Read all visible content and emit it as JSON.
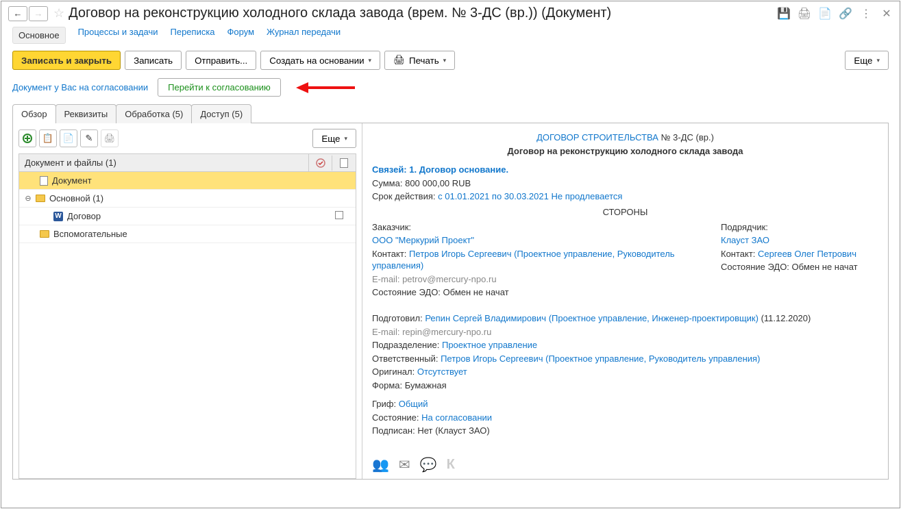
{
  "title": "Договор на реконструкцию холодного склада завода (врем. № 3-ДС (вр.)) (Документ)",
  "nav": {
    "main": "Основное",
    "processes": "Процессы и задачи",
    "correspondence": "Переписка",
    "forum": "Форум",
    "transferlog": "Журнал передачи"
  },
  "toolbar": {
    "save_close": "Записать и закрыть",
    "save": "Записать",
    "send": "Отправить...",
    "create_based": "Создать на основании",
    "print": "Печать",
    "more": "Еще"
  },
  "status": {
    "text": "Документ у Вас на согласовании",
    "action": "Перейти к согласованию"
  },
  "tabs": {
    "overview": "Обзор",
    "props": "Реквизиты",
    "processing": "Обработка (5)",
    "access": "Доступ (5)"
  },
  "tree": {
    "header": "Документ и файлы (1)",
    "r1": "Документ",
    "r2": "Основной (1)",
    "r3": "Договор",
    "r4": "Вспомогательные"
  },
  "more": "Еще",
  "doc": {
    "type": "ДОГОВОР СТРОИТЕЛЬСТВА",
    "num": "№ 3-ДС (вр.)",
    "name": "Договор на реконструкцию холодного склада завода",
    "links": "Связей: 1. Договор основание.",
    "sum_label": "Сумма:",
    "sum": "800 000,00 RUB",
    "period_label": "Срок действия:",
    "period": "с 01.01.2021 по 30.03.2021 Не продлевается",
    "sides": "СТОРОНЫ",
    "customer_label": "Заказчик:",
    "customer": "ООО \"Меркурий Проект\"",
    "contact_label": "Контакт:",
    "customer_contact": "Петров Игорь Сергеевич (Проектное управление, Руководитель управления)",
    "email_label": "E-mail:",
    "customer_email": "petrov@mercury-npo.ru",
    "edo_label": "Состояние ЭДО:",
    "edo_val": "Обмен не начат",
    "contractor_label": "Подрядчик:",
    "contractor": "Клауст ЗАО",
    "contractor_contact": "Сергеев Олег Петрович",
    "prepared_label": "Подготовил:",
    "prepared": "Репин Сергей Владимирович (Проектное управление, Инженер-проектировщик)",
    "prepared_date": "(11.12.2020)",
    "prepared_email": "repin@mercury-npo.ru",
    "dept_label": "Подразделение:",
    "dept": "Проектное управление",
    "resp_label": "Ответственный:",
    "resp": "Петров Игорь Сергеевич (Проектное управление, Руководитель управления)",
    "orig_label": "Оригинал:",
    "orig": "Отсутствует",
    "form_label": "Форма:",
    "form": "Бумажная",
    "grif_label": "Гриф:",
    "grif": "Общий",
    "state_label": "Состояние:",
    "state": "На согласовании",
    "signed_label": "Подписан:",
    "signed": "Нет (Клауст ЗАО)"
  },
  "lefttoolbar_more": "Еще"
}
